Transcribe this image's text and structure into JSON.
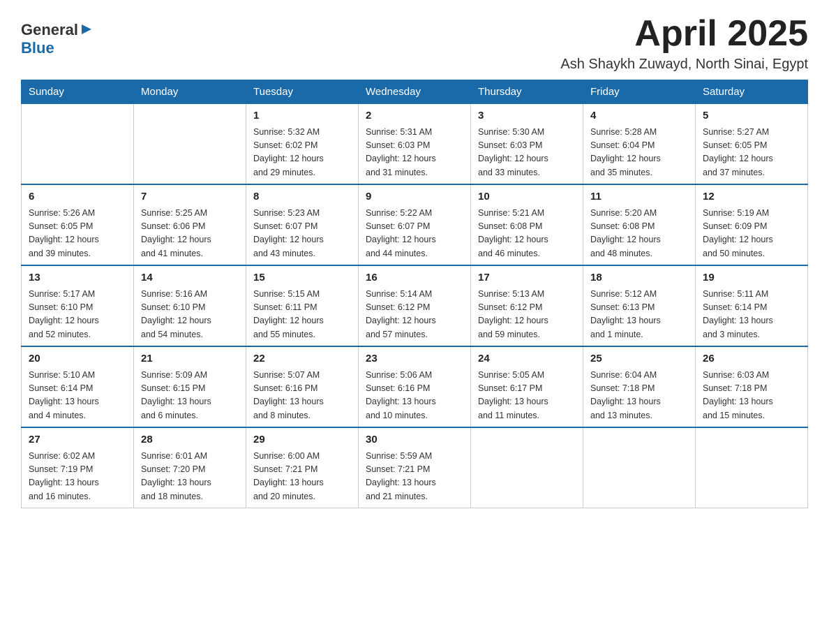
{
  "header": {
    "logo_general": "General",
    "logo_blue": "Blue",
    "month_title": "April 2025",
    "location": "Ash Shaykh Zuwayd, North Sinai, Egypt"
  },
  "days_of_week": [
    "Sunday",
    "Monday",
    "Tuesday",
    "Wednesday",
    "Thursday",
    "Friday",
    "Saturday"
  ],
  "weeks": [
    [
      {
        "day": "",
        "info": ""
      },
      {
        "day": "",
        "info": ""
      },
      {
        "day": "1",
        "info": "Sunrise: 5:32 AM\nSunset: 6:02 PM\nDaylight: 12 hours\nand 29 minutes."
      },
      {
        "day": "2",
        "info": "Sunrise: 5:31 AM\nSunset: 6:03 PM\nDaylight: 12 hours\nand 31 minutes."
      },
      {
        "day": "3",
        "info": "Sunrise: 5:30 AM\nSunset: 6:03 PM\nDaylight: 12 hours\nand 33 minutes."
      },
      {
        "day": "4",
        "info": "Sunrise: 5:28 AM\nSunset: 6:04 PM\nDaylight: 12 hours\nand 35 minutes."
      },
      {
        "day": "5",
        "info": "Sunrise: 5:27 AM\nSunset: 6:05 PM\nDaylight: 12 hours\nand 37 minutes."
      }
    ],
    [
      {
        "day": "6",
        "info": "Sunrise: 5:26 AM\nSunset: 6:05 PM\nDaylight: 12 hours\nand 39 minutes."
      },
      {
        "day": "7",
        "info": "Sunrise: 5:25 AM\nSunset: 6:06 PM\nDaylight: 12 hours\nand 41 minutes."
      },
      {
        "day": "8",
        "info": "Sunrise: 5:23 AM\nSunset: 6:07 PM\nDaylight: 12 hours\nand 43 minutes."
      },
      {
        "day": "9",
        "info": "Sunrise: 5:22 AM\nSunset: 6:07 PM\nDaylight: 12 hours\nand 44 minutes."
      },
      {
        "day": "10",
        "info": "Sunrise: 5:21 AM\nSunset: 6:08 PM\nDaylight: 12 hours\nand 46 minutes."
      },
      {
        "day": "11",
        "info": "Sunrise: 5:20 AM\nSunset: 6:08 PM\nDaylight: 12 hours\nand 48 minutes."
      },
      {
        "day": "12",
        "info": "Sunrise: 5:19 AM\nSunset: 6:09 PM\nDaylight: 12 hours\nand 50 minutes."
      }
    ],
    [
      {
        "day": "13",
        "info": "Sunrise: 5:17 AM\nSunset: 6:10 PM\nDaylight: 12 hours\nand 52 minutes."
      },
      {
        "day": "14",
        "info": "Sunrise: 5:16 AM\nSunset: 6:10 PM\nDaylight: 12 hours\nand 54 minutes."
      },
      {
        "day": "15",
        "info": "Sunrise: 5:15 AM\nSunset: 6:11 PM\nDaylight: 12 hours\nand 55 minutes."
      },
      {
        "day": "16",
        "info": "Sunrise: 5:14 AM\nSunset: 6:12 PM\nDaylight: 12 hours\nand 57 minutes."
      },
      {
        "day": "17",
        "info": "Sunrise: 5:13 AM\nSunset: 6:12 PM\nDaylight: 12 hours\nand 59 minutes."
      },
      {
        "day": "18",
        "info": "Sunrise: 5:12 AM\nSunset: 6:13 PM\nDaylight: 13 hours\nand 1 minute."
      },
      {
        "day": "19",
        "info": "Sunrise: 5:11 AM\nSunset: 6:14 PM\nDaylight: 13 hours\nand 3 minutes."
      }
    ],
    [
      {
        "day": "20",
        "info": "Sunrise: 5:10 AM\nSunset: 6:14 PM\nDaylight: 13 hours\nand 4 minutes."
      },
      {
        "day": "21",
        "info": "Sunrise: 5:09 AM\nSunset: 6:15 PM\nDaylight: 13 hours\nand 6 minutes."
      },
      {
        "day": "22",
        "info": "Sunrise: 5:07 AM\nSunset: 6:16 PM\nDaylight: 13 hours\nand 8 minutes."
      },
      {
        "day": "23",
        "info": "Sunrise: 5:06 AM\nSunset: 6:16 PM\nDaylight: 13 hours\nand 10 minutes."
      },
      {
        "day": "24",
        "info": "Sunrise: 5:05 AM\nSunset: 6:17 PM\nDaylight: 13 hours\nand 11 minutes."
      },
      {
        "day": "25",
        "info": "Sunrise: 6:04 AM\nSunset: 7:18 PM\nDaylight: 13 hours\nand 13 minutes."
      },
      {
        "day": "26",
        "info": "Sunrise: 6:03 AM\nSunset: 7:18 PM\nDaylight: 13 hours\nand 15 minutes."
      }
    ],
    [
      {
        "day": "27",
        "info": "Sunrise: 6:02 AM\nSunset: 7:19 PM\nDaylight: 13 hours\nand 16 minutes."
      },
      {
        "day": "28",
        "info": "Sunrise: 6:01 AM\nSunset: 7:20 PM\nDaylight: 13 hours\nand 18 minutes."
      },
      {
        "day": "29",
        "info": "Sunrise: 6:00 AM\nSunset: 7:21 PM\nDaylight: 13 hours\nand 20 minutes."
      },
      {
        "day": "30",
        "info": "Sunrise: 5:59 AM\nSunset: 7:21 PM\nDaylight: 13 hours\nand 21 minutes."
      },
      {
        "day": "",
        "info": ""
      },
      {
        "day": "",
        "info": ""
      },
      {
        "day": "",
        "info": ""
      }
    ]
  ]
}
